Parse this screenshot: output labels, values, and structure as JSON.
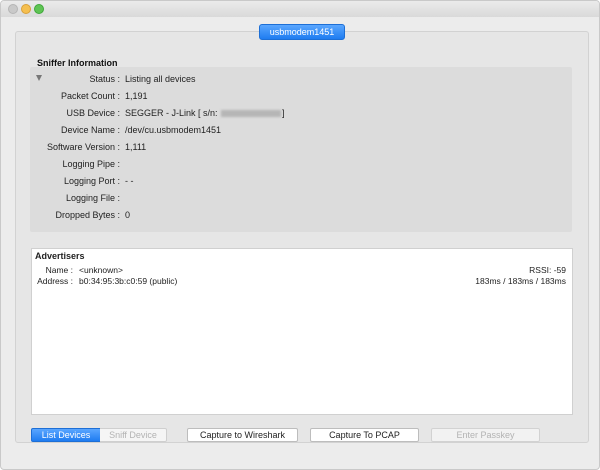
{
  "window": {
    "device_tab": "usbmodem1451"
  },
  "sniffer": {
    "title": "Sniffer Information",
    "rows": [
      {
        "label": "Status :",
        "value": "Listing all devices"
      },
      {
        "label": "Packet Count :",
        "value": "1,191"
      },
      {
        "label": "USB Device :",
        "value_prefix": "SEGGER - J-Link [ s/n:",
        "value_suffix": "]"
      },
      {
        "label": "Device Name :",
        "value": "/dev/cu.usbmodem1451"
      },
      {
        "label": "Software Version :",
        "value": "1,111"
      },
      {
        "label": "Logging Pipe :",
        "value": ""
      },
      {
        "label": "Logging Port :",
        "value": "- -"
      },
      {
        "label": "Logging File :",
        "value": ""
      },
      {
        "label": "Dropped Bytes :",
        "value": "0"
      }
    ]
  },
  "advertisers": {
    "title": "Advertisers",
    "name_label": "Name :",
    "name_value": "<unknown>",
    "address_label": "Address :",
    "address_value": "b0:34:95:3b:c0:59 (public)",
    "rssi": "RSSI: -59",
    "timing": "183ms / 183ms / 183ms"
  },
  "buttons": {
    "list_devices": "List Devices",
    "sniff_device": "Sniff Device",
    "capture_wireshark": "Capture to Wireshark",
    "capture_pcap": "Capture To PCAP",
    "enter_passkey": "Enter Passkey"
  }
}
